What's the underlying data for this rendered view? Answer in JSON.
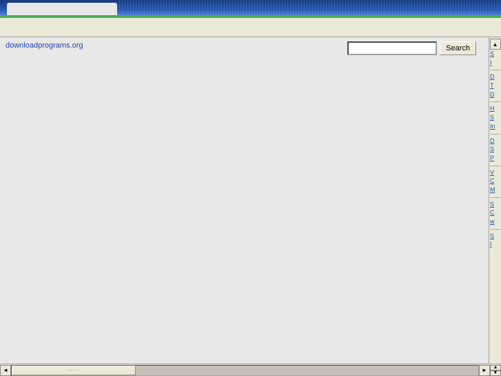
{
  "header": {
    "tab_label": ""
  },
  "toolbar": {
    "search_placeholder": "",
    "search_button_label": "Search"
  },
  "content": {
    "site_title": "downloadprograms.org"
  },
  "sidebar": {
    "links_group1": [
      "S",
      "I",
      "D",
      "T",
      "D"
    ],
    "links_group2": [
      "H",
      "S",
      "In"
    ],
    "links_group3": [
      "D",
      "S",
      "P"
    ],
    "links_group4": [
      "V",
      "C",
      "M"
    ],
    "links_group5": [
      "S",
      "C",
      "w"
    ],
    "links_group6": [
      "S",
      "I"
    ]
  }
}
